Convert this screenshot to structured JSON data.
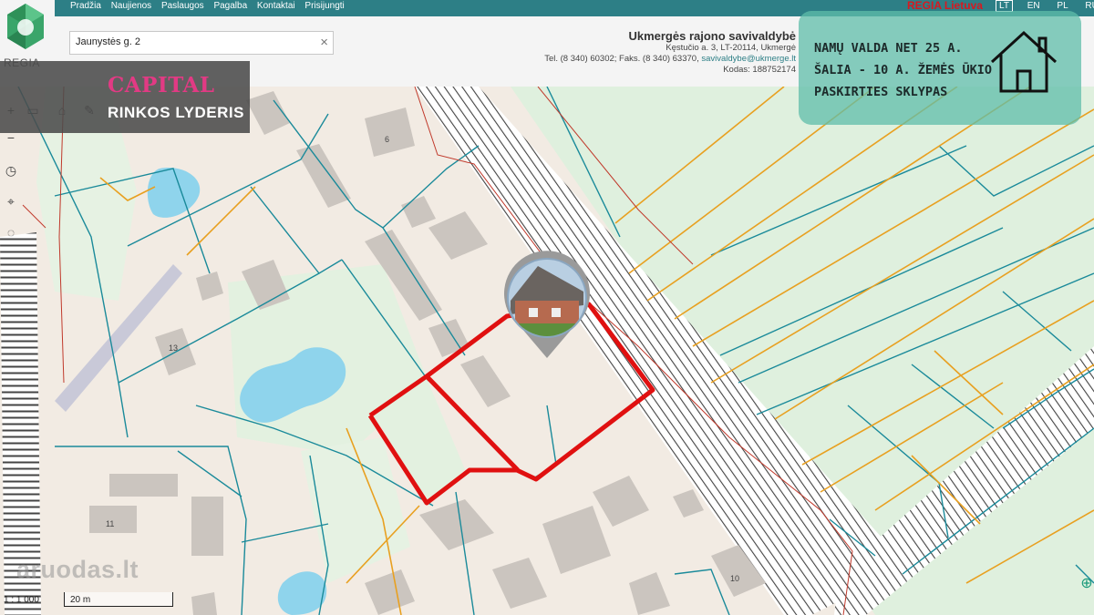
{
  "nav": {
    "links": [
      "Pradžia",
      "Naujienos",
      "Paslaugos",
      "Pagalba",
      "Kontaktai",
      "Prisijungti"
    ],
    "brand": "REGIA Lietuva",
    "languages": [
      "LT",
      "EN",
      "PL",
      "RU"
    ],
    "active_language": "LT"
  },
  "logo": {
    "label": "REGIA"
  },
  "search": {
    "value": "Jaunystės g. 2",
    "clear": "×"
  },
  "municipality": {
    "name": "Ukmergės rajono savivaldybė",
    "address": "Kęstučio a. 3, LT-20114, Ukmergė",
    "phone_prefix": "Tel. (8 340) 60302; Faks. (8 340) 63370,",
    "email": "savivaldybe@ukmerge.lt",
    "code": "Kodas: 188752174"
  },
  "capital": {
    "logo": "CAPITAL",
    "slogan": "RINKOS LYDERIS"
  },
  "info": {
    "lines": [
      "NAMŲ VALDA NET 25 A.",
      "ŠALIA - 10 A. ŽEMĖS ŪKIO",
      "PASKIRTIES SKLYPAS"
    ],
    "icon": "house-icon"
  },
  "map": {
    "labels": {
      "6": "6",
      "13": "13",
      "11": "11",
      "10": "10"
    },
    "scale_ratio": "1 : 1 000",
    "scale_bar": "20 m",
    "watermark": "aruodas.lt"
  },
  "colors": {
    "nav": "#2d7f86",
    "brand": "#d71920",
    "plot_outline": "#e01010",
    "parcel_line": "#1a8a9a",
    "orange_line": "#e8a020",
    "capital": "#e23a84",
    "info_box": "#5fbeaa"
  }
}
